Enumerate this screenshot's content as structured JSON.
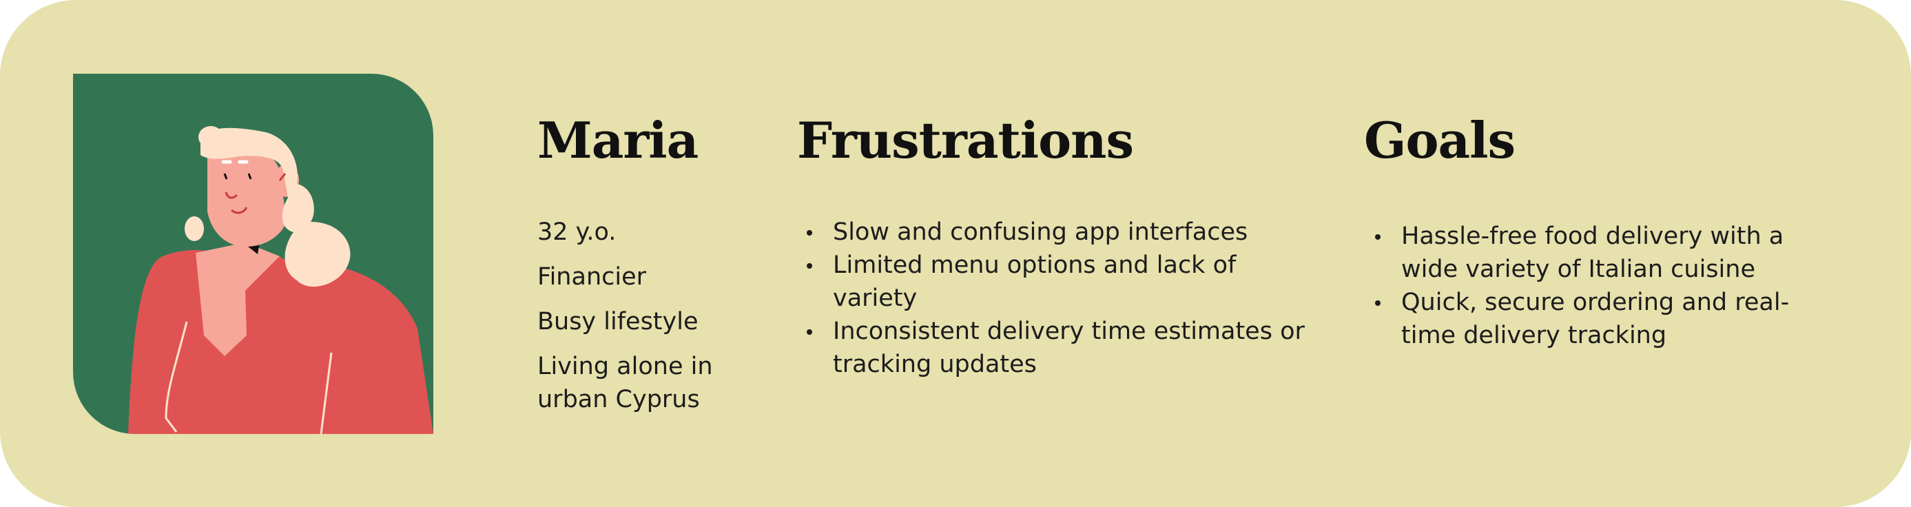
{
  "persona": {
    "name": "Maria",
    "details": [
      "32 y.o.",
      "Financier",
      "Busy lifestyle",
      "Living alone in urban Cyprus"
    ]
  },
  "frustrations": {
    "title": "Frustrations",
    "items": [
      "Slow and confusing app interfaces",
      "Limited menu options and lack of variety",
      "Inconsistent delivery time estimates or tracking updates"
    ]
  },
  "goals": {
    "title": "Goals",
    "items": [
      "Hassle-free food delivery with a wide variety of Italian cuisine",
      "Quick, secure ordering and real-time delivery tracking"
    ]
  },
  "colors": {
    "card_background": "#e6e1ad",
    "avatar_background": "#337553",
    "shirt": "#e05353",
    "skin": "#f6a799",
    "hair": "#fde2c9"
  }
}
